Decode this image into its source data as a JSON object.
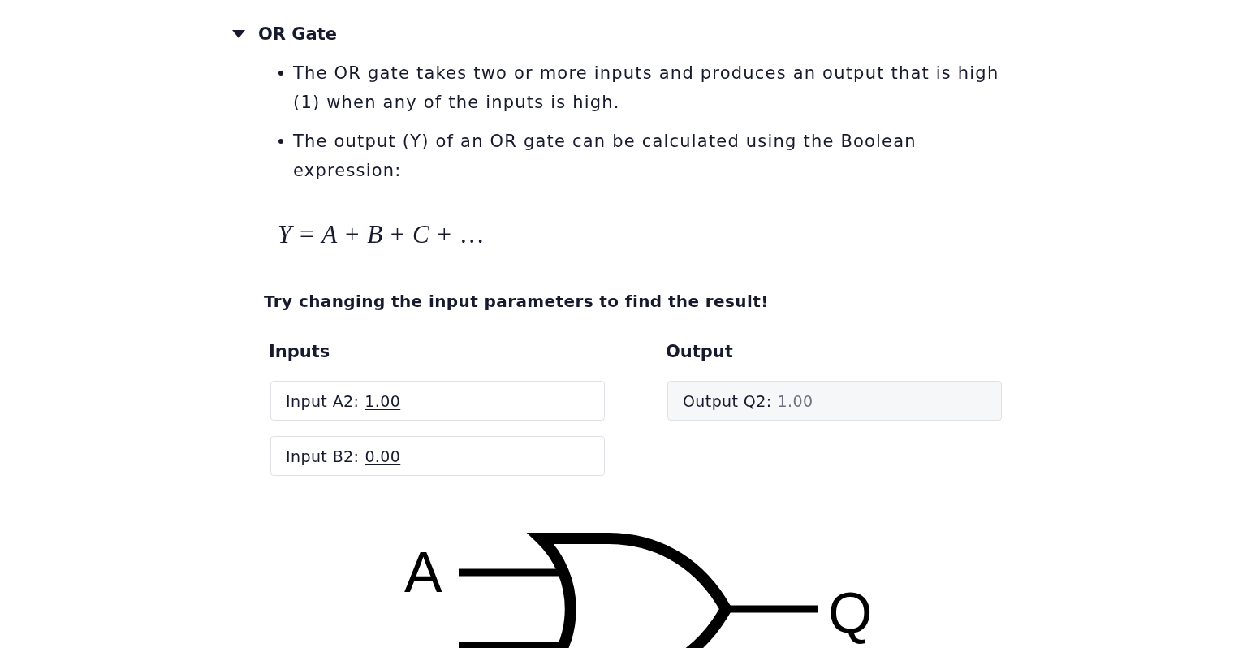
{
  "section": {
    "title": "OR Gate",
    "expanded": true,
    "bullets": [
      "The OR gate takes two or more inputs and produces an output that is high (1) when any of the inputs is high.",
      "The output (Y) of an OR gate can be calculated using the Boolean expression:"
    ],
    "formula": "*Y* = *A* + *B* + *C* + …",
    "prompt": "Try changing the input parameters to find the result!",
    "inputs": {
      "heading": "Inputs",
      "fields": [
        {
          "label": "Input A2:",
          "value": "1.00"
        },
        {
          "label": "Input B2:",
          "value": "0.00"
        }
      ]
    },
    "output": {
      "heading": "Output",
      "fields": [
        {
          "label": "Output Q2:",
          "value": "1.00"
        }
      ]
    },
    "diagram": {
      "input_labels": [
        "A"
      ],
      "output_label": "Q"
    }
  }
}
